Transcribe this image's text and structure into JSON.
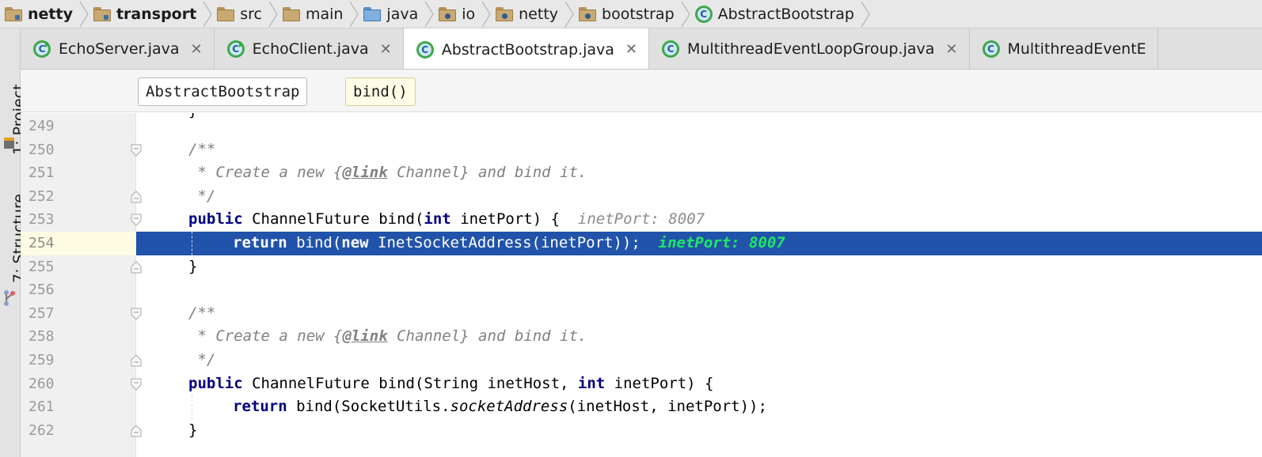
{
  "breadcrumbs": [
    {
      "label": "netty",
      "icon": "module-folder-icon",
      "bold": true
    },
    {
      "label": "transport",
      "icon": "module-folder-icon",
      "bold": true
    },
    {
      "label": "src",
      "icon": "folder-icon",
      "bold": false
    },
    {
      "label": "main",
      "icon": "folder-icon",
      "bold": false
    },
    {
      "label": "java",
      "icon": "source-root-folder-icon",
      "bold": false
    },
    {
      "label": "io",
      "icon": "package-icon",
      "bold": false
    },
    {
      "label": "netty",
      "icon": "package-icon",
      "bold": false
    },
    {
      "label": "bootstrap",
      "icon": "package-icon",
      "bold": false
    },
    {
      "label": "AbstractBootstrap",
      "icon": "class-icon",
      "bold": false
    }
  ],
  "tool_windows": {
    "project": "1: Project",
    "structure": "7: Structure"
  },
  "tabs": [
    {
      "label": "EchoServer.java",
      "active": false,
      "runnable": true
    },
    {
      "label": "EchoClient.java",
      "active": false,
      "runnable": true
    },
    {
      "label": "AbstractBootstrap.java",
      "active": true,
      "runnable": false
    },
    {
      "label": "MultithreadEventLoopGroup.java",
      "active": false,
      "runnable": false
    },
    {
      "label": "MultithreadEventE",
      "active": false,
      "runnable": false
    }
  ],
  "close_glyph": "✕",
  "structure_nav": {
    "class": "AbstractBootstrap",
    "method": "bind()"
  },
  "code_lines": [
    {
      "n": "249",
      "fold": "none",
      "text": ""
    },
    {
      "n": "250",
      "fold": "open",
      "text": "/**"
    },
    {
      "n": "251",
      "fold": "none",
      "text": " * Create a new {@link Channel} and bind it."
    },
    {
      "n": "252",
      "fold": "close",
      "text": " */"
    },
    {
      "n": "253",
      "fold": "open",
      "text": "public ChannelFuture bind(int inetPort) {"
    },
    {
      "n": "254",
      "fold": "none",
      "text": "return bind(new InetSocketAddress(inetPort));"
    },
    {
      "n": "255",
      "fold": "close",
      "text": "}"
    },
    {
      "n": "256",
      "fold": "none",
      "text": ""
    },
    {
      "n": "257",
      "fold": "open",
      "text": "/**"
    },
    {
      "n": "258",
      "fold": "none",
      "text": " * Create a new {@link Channel} and bind it."
    },
    {
      "n": "259",
      "fold": "close",
      "text": " */"
    },
    {
      "n": "260",
      "fold": "open",
      "text": "public ChannelFuture bind(String inetHost, int inetPort) {"
    },
    {
      "n": "261",
      "fold": "none",
      "text": "return bind(SocketUtils.socketAddress(inetHost, inetPort));"
    },
    {
      "n": "262",
      "fold": "close",
      "text": "}"
    }
  ],
  "inlay_hints": {
    "line_253": "inetPort: 8007",
    "line_254": "inetPort: 8007"
  },
  "selected_line": "254",
  "colors": {
    "selection": "#2153ab",
    "keyword": "#000080",
    "comment": "#808080",
    "hint_on_selection": "#1ee864"
  }
}
